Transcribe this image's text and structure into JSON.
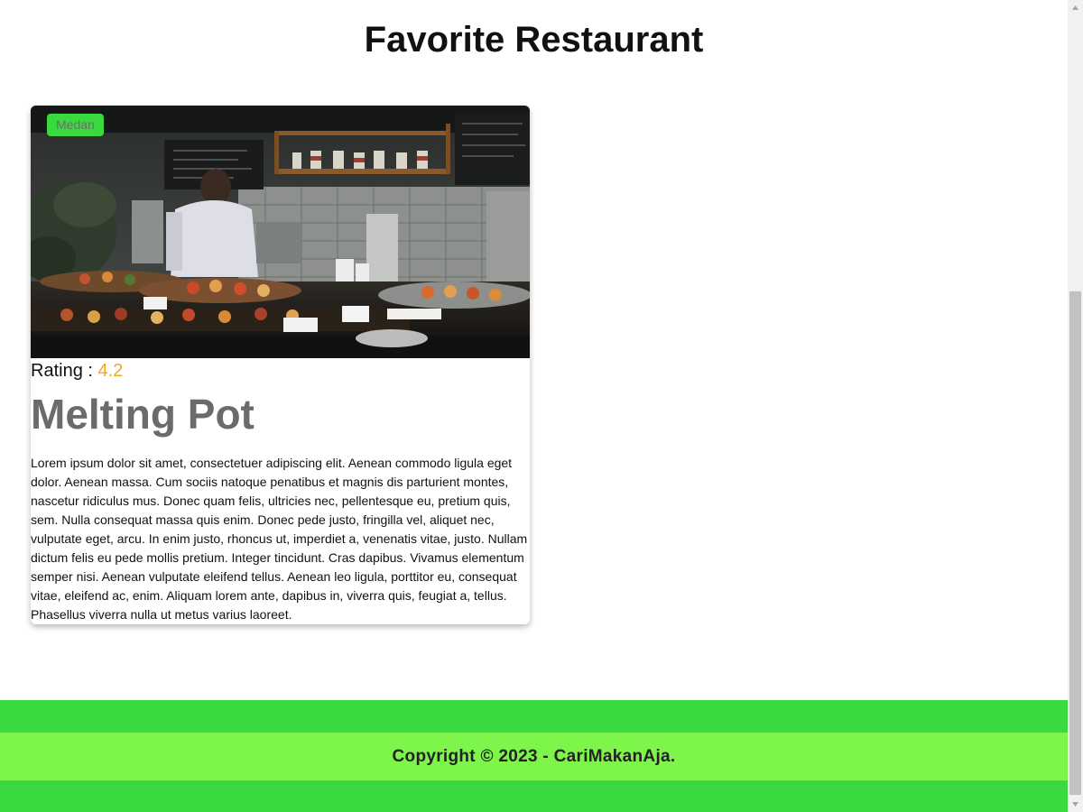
{
  "page": {
    "title": "Favorite Restaurant"
  },
  "restaurant": {
    "city": "Medan",
    "rating_label": "Rating : ",
    "rating": "4.2",
    "name": "Melting Pot",
    "description": "Lorem ipsum dolor sit amet, consectetuer adipiscing elit. Aenean commodo ligula eget dolor. Aenean massa. Cum sociis natoque penatibus et magnis dis parturient montes, nascetur ridiculus mus. Donec quam felis, ultricies nec, pellentesque eu, pretium quis, sem. Nulla consequat massa quis enim. Donec pede justo, fringilla vel, aliquet nec, vulputate eget, arcu. In enim justo, rhoncus ut, imperdiet a, venenatis vitae, justo. Nullam dictum felis eu pede mollis pretium. Integer tincidunt. Cras dapibus. Vivamus elementum semper nisi. Aenean vulputate eleifend tellus. Aenean leo ligula, porttitor eu, consequat vitae, eleifend ac, enim. Aliquam lorem ante, dapibus in, viverra quis, feugiat a, tellus. Phasellus viverra nulla ut metus varius laoreet."
  },
  "footer": {
    "text": "Copyright © 2023 - CariMakanAja."
  },
  "colors": {
    "accent_green": "#3ad940",
    "light_green": "#7ef54b",
    "rating_orange": "#f5a623",
    "name_gray": "#6b6b6b"
  }
}
